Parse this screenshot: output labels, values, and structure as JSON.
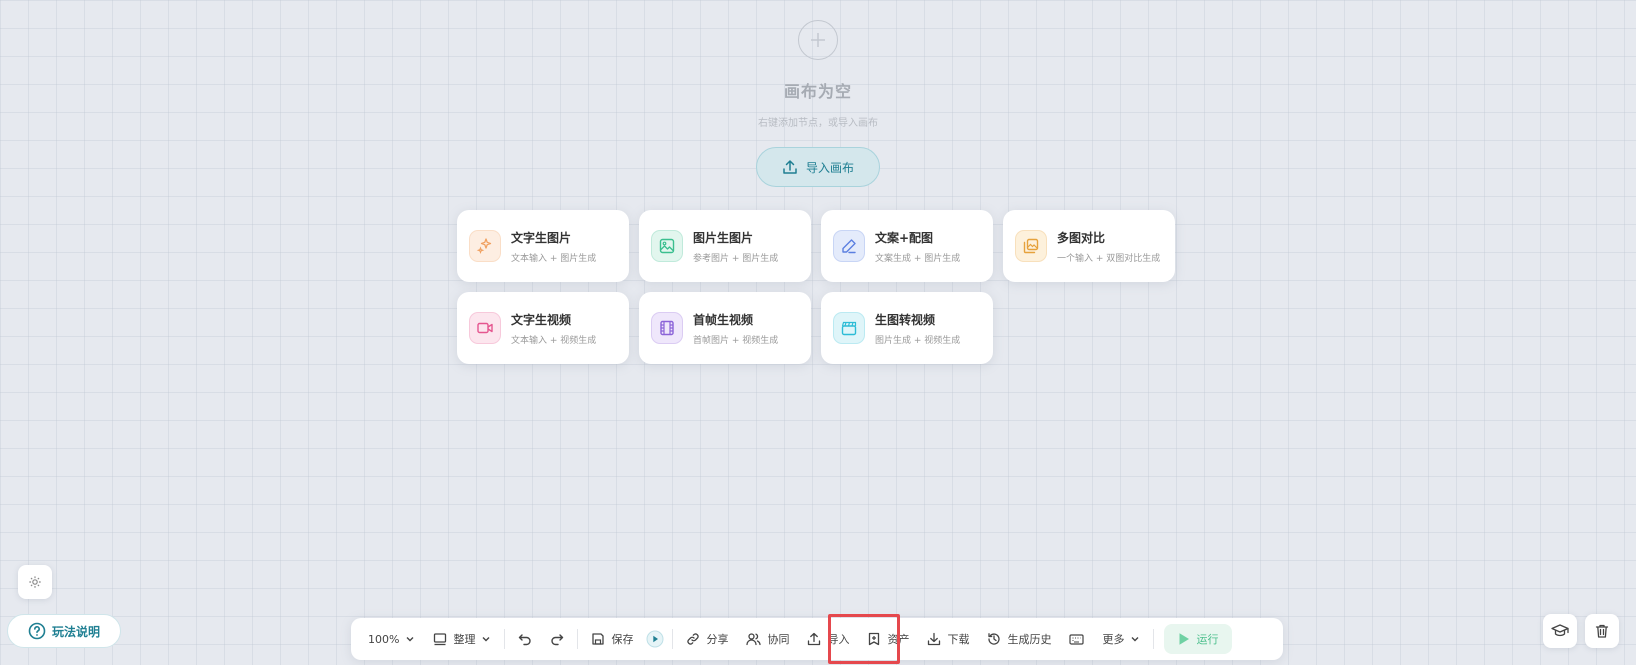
{
  "empty": {
    "title": "画布为空",
    "subtitle": "右键添加节点，或导入画布",
    "import_button": "导入画布"
  },
  "cards": [
    {
      "title": "文字生图片",
      "desc": "文本输入 + 图片生成",
      "icon": "sparkle-icon",
      "color": "#f0a060",
      "bg": "#fdeee2"
    },
    {
      "title": "图片生图片",
      "desc": "参考图片 + 图片生成",
      "icon": "image-icon",
      "color": "#3bbf8f",
      "bg": "#e2f6ee"
    },
    {
      "title": "文案+配图",
      "desc": "文案生成 + 图片生成",
      "icon": "pen-icon",
      "color": "#5b7fe0",
      "bg": "#e4ebfb"
    },
    {
      "title": "多图对比",
      "desc": "一个输入 + 双图对比生成",
      "icon": "gallery-icon",
      "color": "#e6a23c",
      "bg": "#fdf1dc"
    },
    {
      "title": "文字生视频",
      "desc": "文本输入 + 视频生成",
      "icon": "video-icon",
      "color": "#e5568f",
      "bg": "#fce6ee"
    },
    {
      "title": "首帧生视频",
      "desc": "首帧图片 + 视频生成",
      "icon": "film-icon",
      "color": "#8b63d8",
      "bg": "#efe7fb"
    },
    {
      "title": "生图转视频",
      "desc": "图片生成 + 视频生成",
      "icon": "clapper-icon",
      "color": "#2cbcd6",
      "bg": "#dff5f9"
    }
  ],
  "toolbar": {
    "zoom": "100%",
    "arrange": "整理",
    "save": "保存",
    "share": "分享",
    "collab": "协同",
    "import": "导入",
    "assets": "资产",
    "download": "下载",
    "history": "生成历史",
    "more": "更多",
    "run": "运行"
  },
  "help": "玩法说明"
}
